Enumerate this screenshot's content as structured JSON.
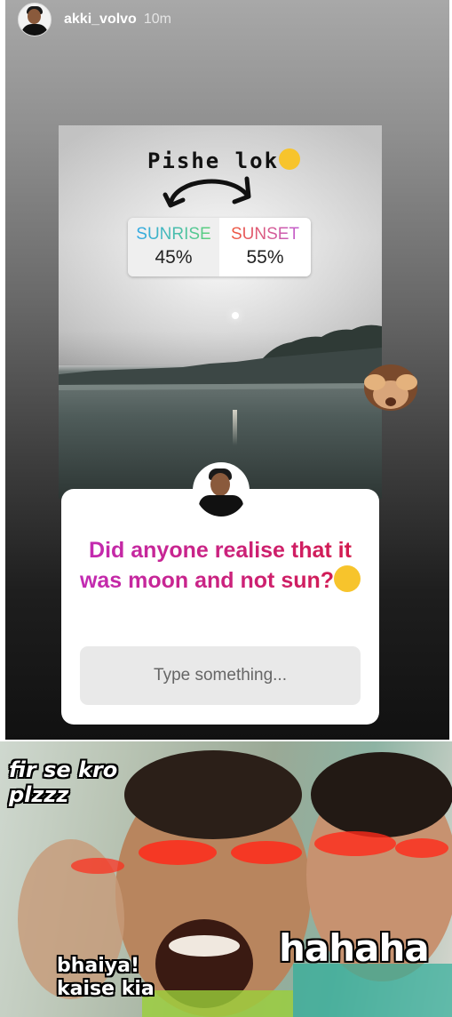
{
  "story": {
    "username": "akki_volvo",
    "time_ago": "10m"
  },
  "photo": {
    "caption": "Pishe lok"
  },
  "poll": {
    "options": [
      {
        "label": "SUNRISE",
        "percent": "45%"
      },
      {
        "label": "SUNSET",
        "percent": "55%"
      }
    ]
  },
  "question": {
    "text": "Did anyone realise that it was moon and not sun?",
    "input_placeholder": "Type something..."
  },
  "meme": {
    "top_left_text": "fir se kro plzzz",
    "bottom_left_text": "bhaiya! kaise kia",
    "bottom_right_text": "hahaha"
  },
  "colors": {
    "question_gradient_start": "#c22bb4",
    "question_gradient_end": "#d31a4a",
    "sunrise_gradient": [
      "#31a8e6",
      "#5fd17a"
    ],
    "sunset_gradient": [
      "#f0583c",
      "#c25fd1"
    ]
  }
}
